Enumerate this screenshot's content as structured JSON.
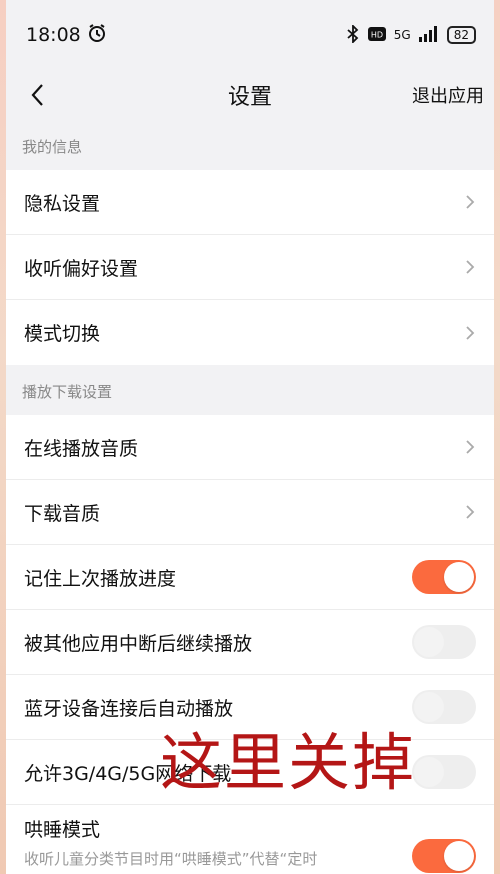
{
  "status": {
    "time": "18:08",
    "network": "5G",
    "battery": "82"
  },
  "nav": {
    "title": "设置",
    "exit_label": "退出应用"
  },
  "sections": {
    "my_info": "我的信息",
    "play_download": "播放下载设置"
  },
  "rows": {
    "privacy": "隐私设置",
    "listening_pref": "收听偏好设置",
    "mode_switch": "模式切换",
    "online_quality": "在线播放音质",
    "download_quality": "下载音质",
    "remember_progress": "记住上次播放进度",
    "resume_after_interrupt": "被其他应用中断后继续播放",
    "bluetooth_autoplay": "蓝牙设备连接后自动播放",
    "allow_mobile_download": "允许3G/4G/5G网络下载",
    "sleep_mode": "哄睡模式",
    "sleep_mode_desc": "收听儿童分类节目时用“哄睡模式”代替“定时"
  },
  "toggles": {
    "remember_progress": true,
    "resume_after_interrupt": false,
    "bluetooth_autoplay": false,
    "allow_mobile_download": false,
    "sleep_mode": true
  },
  "annotation": "这里关掉",
  "colors": {
    "accent": "#fb6a3e",
    "annotation": "#b41616"
  }
}
